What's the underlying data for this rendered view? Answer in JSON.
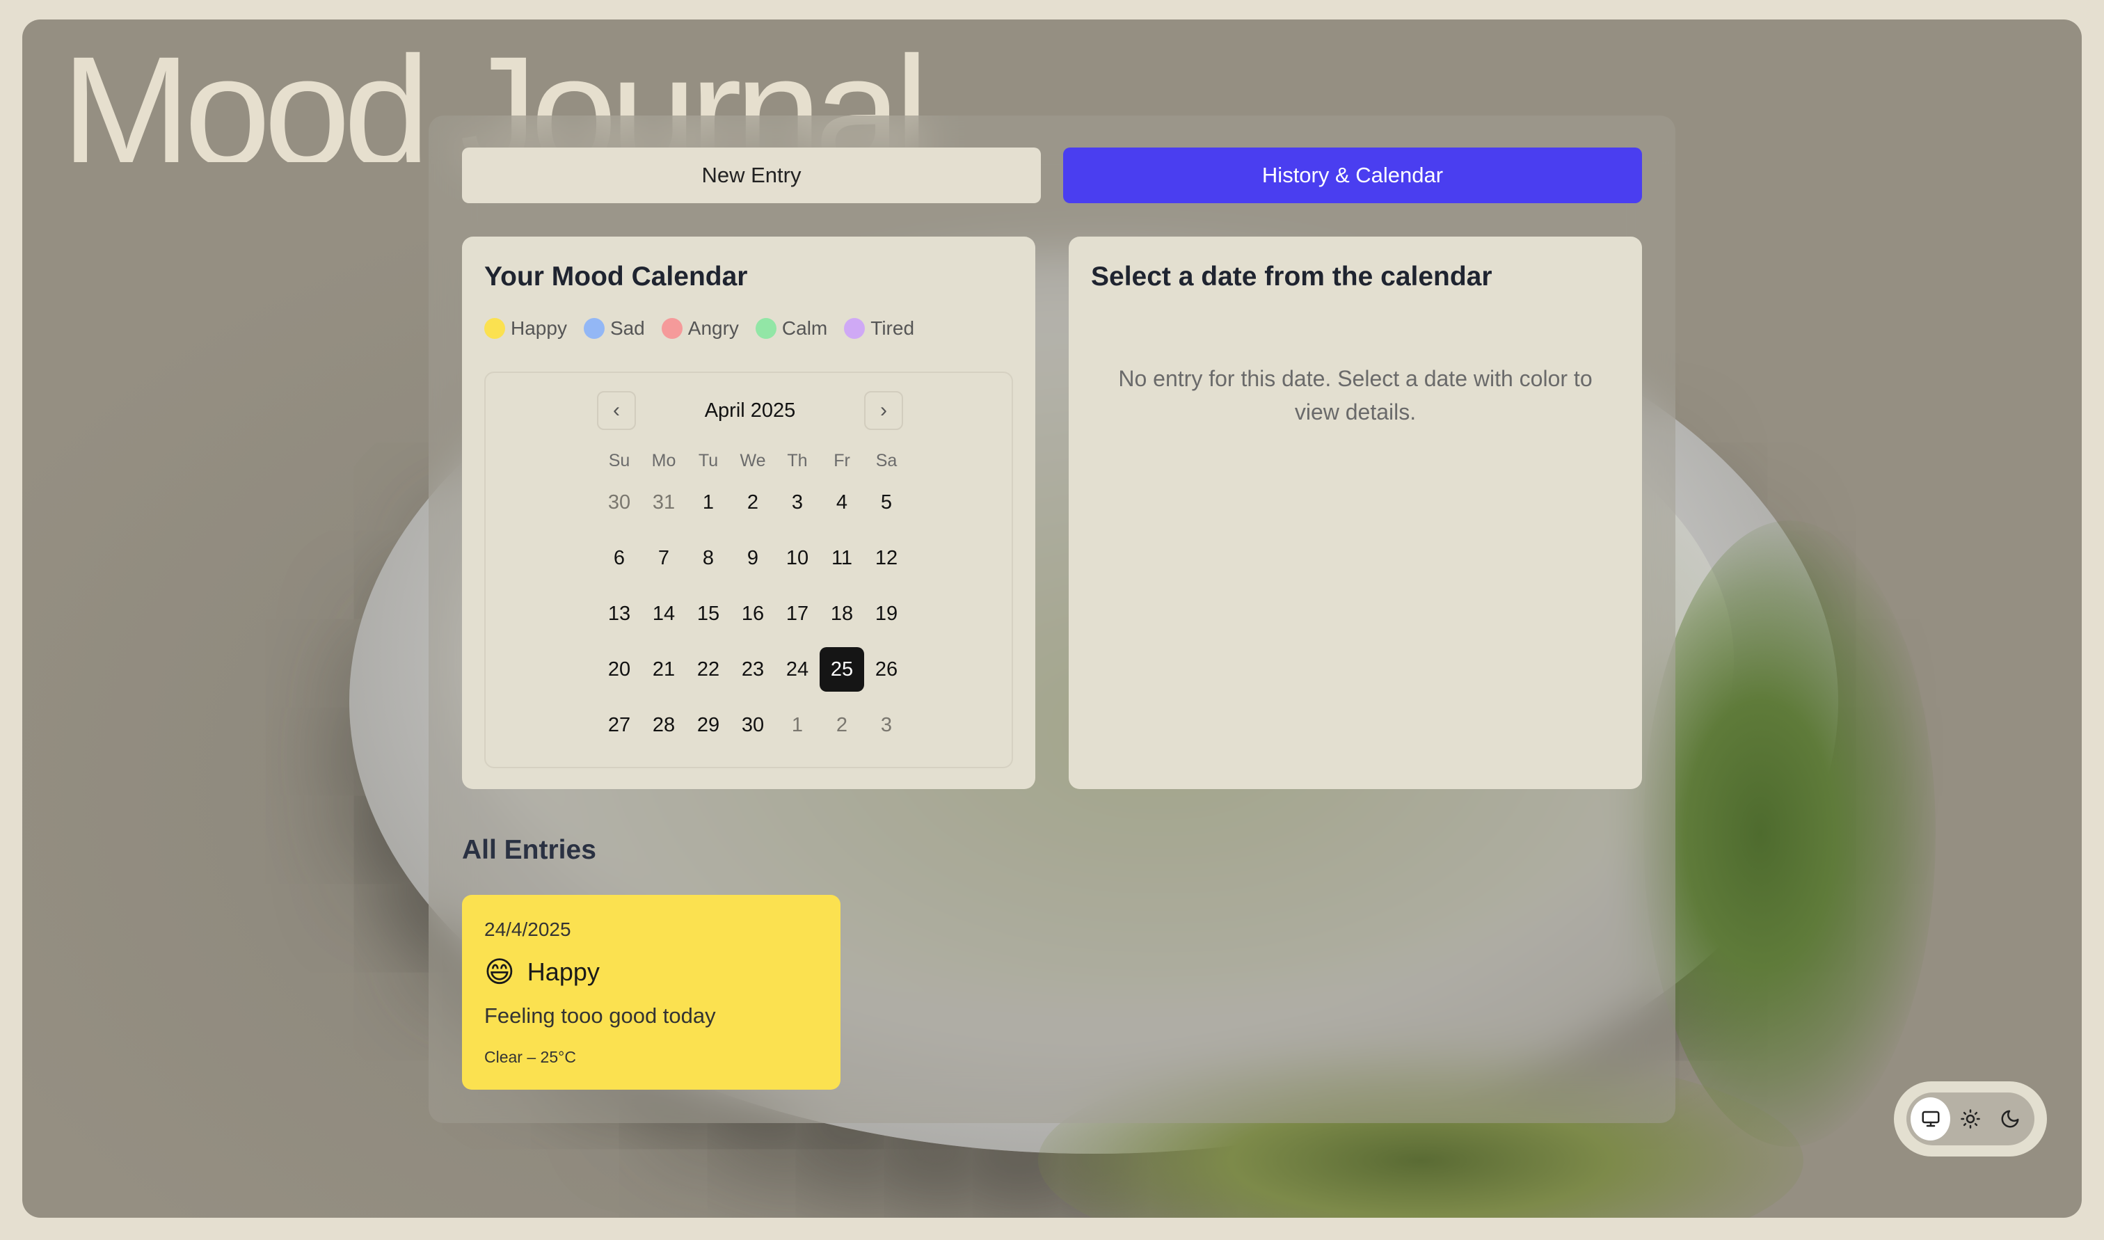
{
  "app": {
    "title": "Mood Journal"
  },
  "tabs": [
    {
      "label": "New Entry",
      "active": false
    },
    {
      "label": "History & Calendar",
      "active": true
    }
  ],
  "calendar_card": {
    "title": "Your Mood Calendar",
    "legend": [
      {
        "label": "Happy",
        "color": "#fbe150"
      },
      {
        "label": "Sad",
        "color": "#93b7f5"
      },
      {
        "label": "Angry",
        "color": "#f59a9a"
      },
      {
        "label": "Calm",
        "color": "#92e6a6"
      },
      {
        "label": "Tired",
        "color": "#cfa9f5"
      }
    ],
    "month_label": "April 2025",
    "weekdays": [
      "Su",
      "Mo",
      "Tu",
      "We",
      "Th",
      "Fr",
      "Sa"
    ],
    "weeks": [
      [
        "30",
        "31",
        "1",
        "2",
        "3",
        "4",
        "5"
      ],
      [
        "6",
        "7",
        "8",
        "9",
        "10",
        "11",
        "12"
      ],
      [
        "13",
        "14",
        "15",
        "16",
        "17",
        "18",
        "19"
      ],
      [
        "20",
        "21",
        "22",
        "23",
        "24",
        "25",
        "26"
      ],
      [
        "27",
        "28",
        "29",
        "30",
        "1",
        "2",
        "3"
      ]
    ],
    "selected_day": "25"
  },
  "detail_card": {
    "title": "Select a date from the calendar",
    "empty_message": "No entry for this date. Select a date with color to view details."
  },
  "entries_section": {
    "title": "All Entries",
    "entries": [
      {
        "date": "24/4/2025",
        "emoji": "😄",
        "mood": "Happy",
        "note": "Feeling tooo good today",
        "weather": "Clear – 25°C",
        "color": "#fbe150"
      }
    ]
  },
  "theme_switcher": {
    "options": [
      "monitor-icon",
      "sun-icon",
      "moon-icon"
    ],
    "active": "monitor-icon"
  }
}
